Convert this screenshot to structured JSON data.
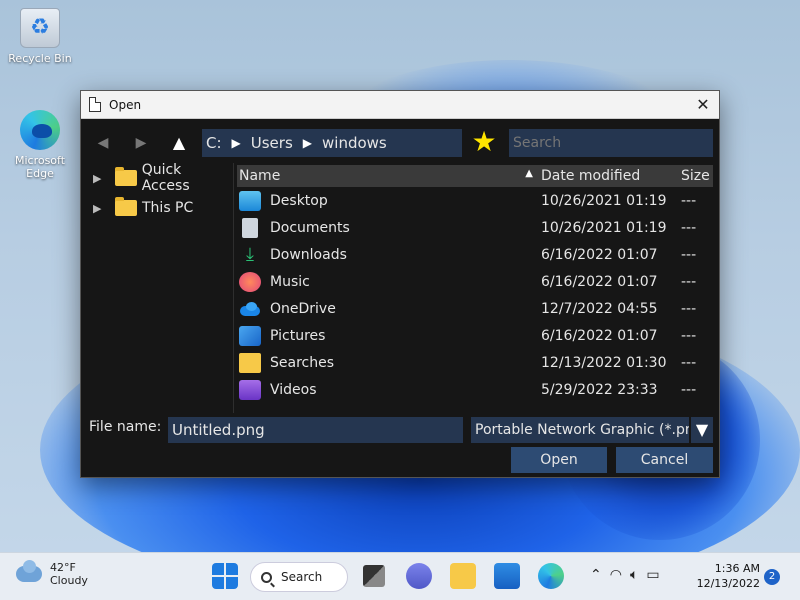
{
  "desktop": {
    "icons": [
      {
        "label": "Recycle Bin",
        "icon": "recycle-bin-icon"
      },
      {
        "label": "Microsoft Edge",
        "icon": "edge-icon"
      }
    ]
  },
  "dialog": {
    "title": "Open",
    "nav": {
      "back_icon": "◀",
      "forward_icon": "▶",
      "up_icon": "▲",
      "path": [
        "C:",
        "Users",
        "windows"
      ],
      "separator": "▶",
      "favorite_icon": "★",
      "search_placeholder": "Search"
    },
    "sidebar": {
      "items": [
        {
          "label": "Quick Access",
          "icon": "folder-icon"
        },
        {
          "label": "This PC",
          "icon": "folder-icon"
        }
      ]
    },
    "columns": {
      "name": "Name",
      "date": "Date modified",
      "size": "Size"
    },
    "files": [
      {
        "name": "Desktop",
        "date": "10/26/2021 01:19",
        "size": "---",
        "icon": "desktop-folder-icon"
      },
      {
        "name": "Documents",
        "date": "10/26/2021 01:19",
        "size": "---",
        "icon": "documents-folder-icon"
      },
      {
        "name": "Downloads",
        "date": "6/16/2022 01:07",
        "size": "---",
        "icon": "downloads-folder-icon"
      },
      {
        "name": "Music",
        "date": "6/16/2022 01:07",
        "size": "---",
        "icon": "music-folder-icon"
      },
      {
        "name": "OneDrive",
        "date": "12/7/2022 04:55",
        "size": "---",
        "icon": "onedrive-icon"
      },
      {
        "name": "Pictures",
        "date": "6/16/2022 01:07",
        "size": "---",
        "icon": "pictures-folder-icon"
      },
      {
        "name": "Searches",
        "date": "12/13/2022 01:30",
        "size": "---",
        "icon": "searches-folder-icon"
      },
      {
        "name": "Videos",
        "date": "5/29/2022 23:33",
        "size": "---",
        "icon": "videos-folder-icon"
      }
    ],
    "filename_label": "File name:",
    "filename_value": "Untitled.png",
    "filetype_value": "Portable Network Graphic (*.png)",
    "open_label": "Open",
    "cancel_label": "Cancel"
  },
  "taskbar": {
    "weather_temp": "42°F",
    "weather_desc": "Cloudy",
    "search_label": "Search",
    "time": "1:36 AM",
    "date": "12/13/2022",
    "notification_count": "2",
    "tray_icons": [
      "chevron-up-icon",
      "wifi-icon",
      "volume-icon",
      "battery-icon"
    ]
  }
}
